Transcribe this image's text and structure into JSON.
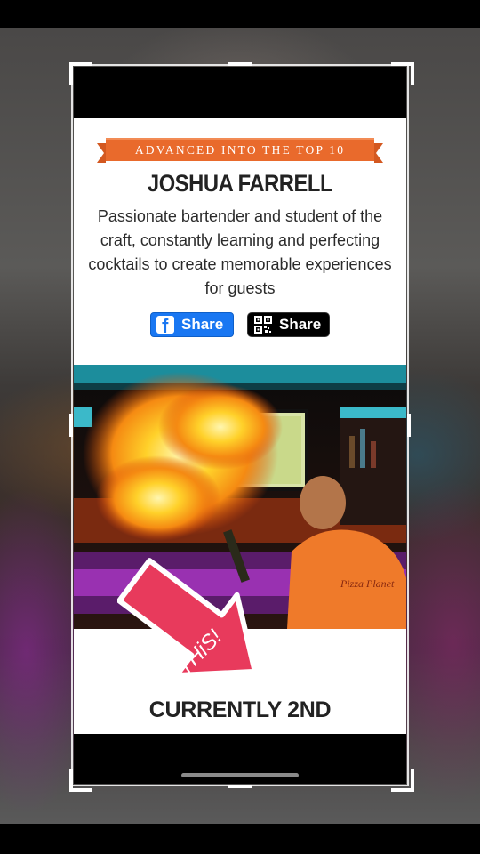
{
  "card": {
    "banner": "ADVANCED INTO THE TOP 10",
    "name": "JOSHUA FARRELL",
    "bio": "Passionate bartender and student of the craft, constantly learning and perfecting cocktails to create memorable experiences for guests",
    "share_facebook_label": "Share",
    "share_qr_label": "Share",
    "photo_shirt_text": "Pizza Planet",
    "sticker_text": "THiS!",
    "status": "CURRENTLY 2ND"
  },
  "icons": {
    "facebook": "facebook-icon",
    "qr": "qr-code-icon",
    "arrow": "arrow-sticker"
  },
  "colors": {
    "ribbon": "#e96a2c",
    "facebook": "#1977f2",
    "sticker": "#e83a5c"
  }
}
